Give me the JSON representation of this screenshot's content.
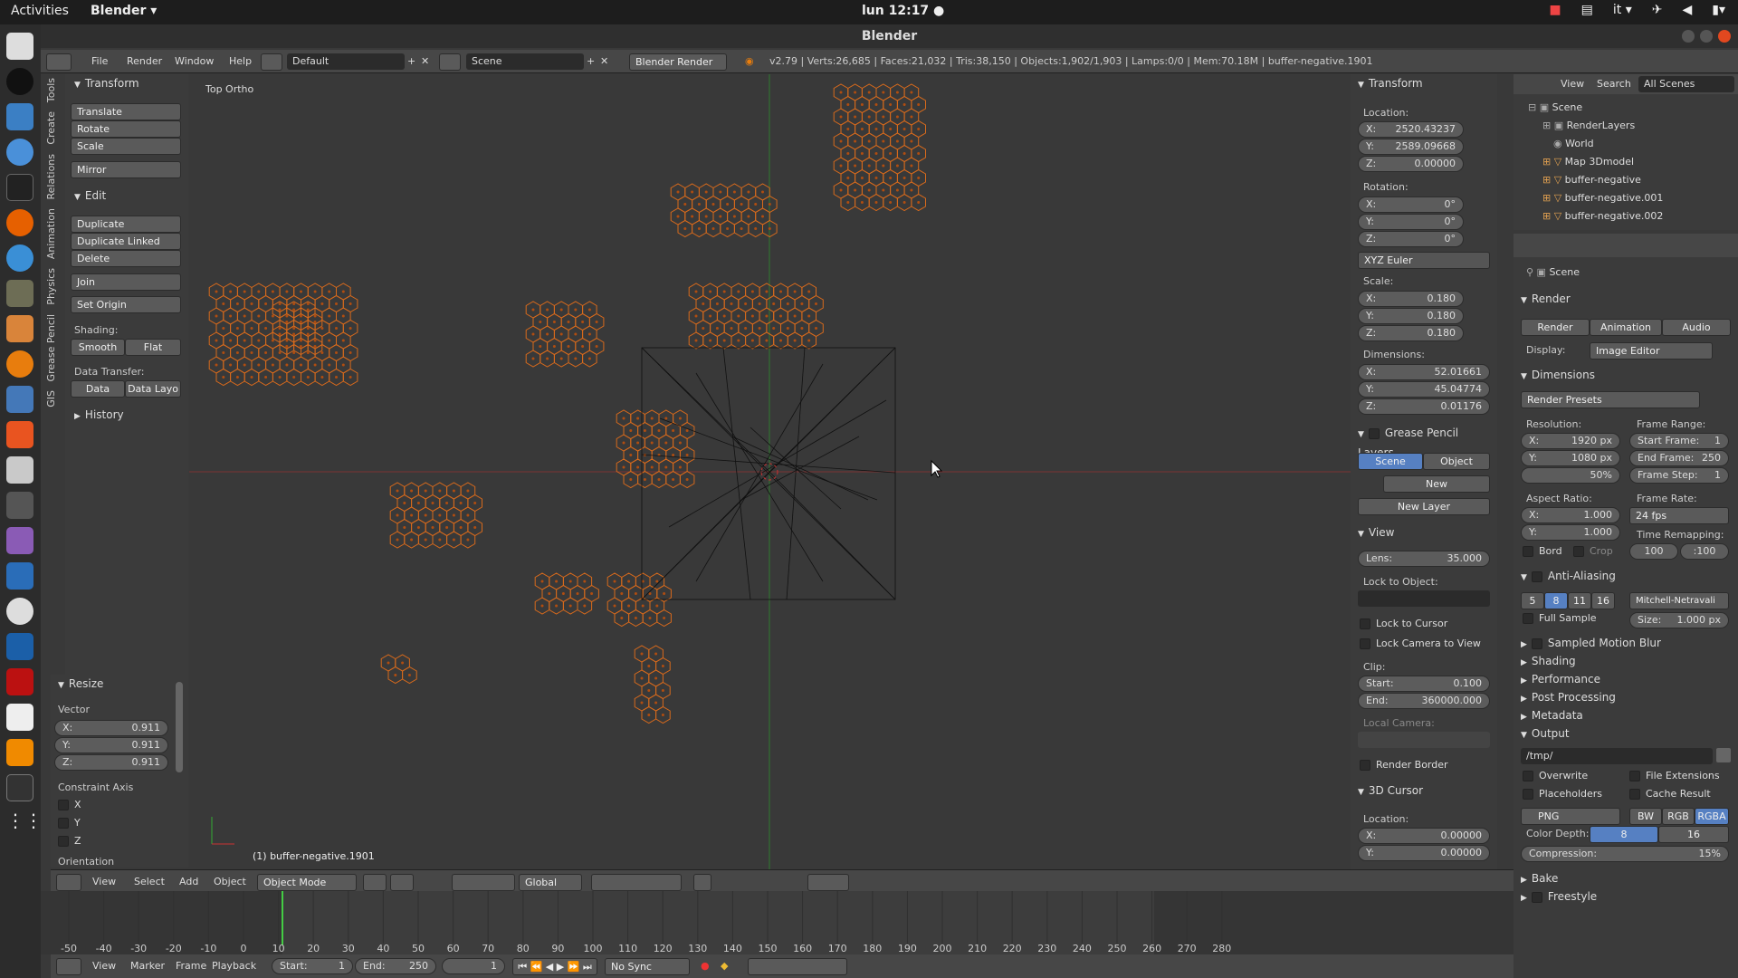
{
  "gnome": {
    "activities": "Activities",
    "app": "Blender ▾",
    "clock": "lun 12:17 ●",
    "lang": "it ▾"
  },
  "window": {
    "title": "Blender"
  },
  "info": {
    "menus": [
      "File",
      "Render",
      "Window",
      "Help"
    ],
    "layout": "Default",
    "scene": "Scene",
    "engine": "Blender Render",
    "stats": "v2.79 | Verts:26,685 | Faces:21,032 | Tris:38,150 | Objects:1,902/1,903 | Lamps:0/0 | Mem:70.18M | buffer-negative.1901"
  },
  "tool_tabs": [
    "Tools",
    "Create",
    "Relations",
    "Animation",
    "Physics",
    "Grease Pencil",
    "GIS"
  ],
  "tools": {
    "transform_hdr": "Transform",
    "translate": "Translate",
    "rotate": "Rotate",
    "scale": "Scale",
    "mirror": "Mirror",
    "edit_hdr": "Edit",
    "duplicate": "Duplicate",
    "duplicate_linked": "Duplicate Linked",
    "delete": "Delete",
    "join": "Join",
    "set_origin": "Set Origin",
    "shading": "Shading:",
    "smooth": "Smooth",
    "flat": "Flat",
    "data_transfer": "Data Transfer:",
    "data": "Data",
    "data_layo": "Data Layo",
    "history": "History"
  },
  "resize": {
    "title": "Resize",
    "vector": "Vector",
    "x": "X:",
    "xv": "0.911",
    "y": "Y:",
    "yv": "0.911",
    "z": "Z:",
    "zv": "0.911",
    "constraint": "Constraint Axis",
    "cx": "X",
    "cy": "Y",
    "cz": "Z",
    "orientation": "Orientation"
  },
  "viewport": {
    "view_name": "Top Ortho",
    "object_label": "(1) buffer-negative.1901"
  },
  "props": {
    "transform": "Transform",
    "location": "Location:",
    "lx": "X:",
    "lxv": "2520.43237",
    "ly": "Y:",
    "lyv": "2589.09668",
    "lz": "Z:",
    "lzv": "0.00000",
    "rotation": "Rotation:",
    "rx": "X:",
    "rxv": "0°",
    "ry": "Y:",
    "ryv": "0°",
    "rz": "Z:",
    "rzv": "0°",
    "euler": "XYZ Euler",
    "scale": "Scale:",
    "sx": "X:",
    "sxv": "0.180",
    "sy": "Y:",
    "syv": "0.180",
    "sz": "Z:",
    "szv": "0.180",
    "dimensions": "Dimensions:",
    "dx": "X:",
    "dxv": "52.01661",
    "dy": "Y:",
    "dyv": "45.04774",
    "dz": "Z:",
    "dzv": "0.01176",
    "gp_layers": "Grease Pencil Layers",
    "scene_btn": "Scene",
    "object_btn": "Object",
    "new": "New",
    "new_layer": "New Layer",
    "view": "View",
    "lens": "Lens:",
    "lensv": "35.000",
    "lock_obj": "Lock to Object:",
    "lock_cursor": "Lock to Cursor",
    "lock_camera": "Lock Camera to View",
    "clip": "Clip:",
    "start": "Start:",
    "startv": "0.100",
    "end": "End:",
    "endv": "360000.000",
    "local_camera": "Local Camera:",
    "render_border": "Render Border",
    "cursor3d": "3D Cursor",
    "c_location": "Location:",
    "cx": "X:",
    "cxv": "0.00000",
    "cy": "Y:",
    "cyv": "0.00000"
  },
  "outliner": {
    "view": "View",
    "search": "Search",
    "all_scenes": "All Scenes",
    "items": [
      "Scene",
      "RenderLayers",
      "World",
      "Map 3Dmodel",
      "buffer-negative",
      "buffer-negative.001",
      "buffer-negative.002"
    ]
  },
  "render": {
    "context": "Scene",
    "render_hdr": "Render",
    "render_btn": "Render",
    "animation_btn": "Animation",
    "audio_btn": "Audio",
    "display": "Display:",
    "display_val": "Image Editor",
    "dimensions": "Dimensions",
    "presets": "Render Presets",
    "resolution": "Resolution:",
    "resx": "X:",
    "resxv": "1920 px",
    "resy": "Y:",
    "resyv": "1080 px",
    "pct": "50%",
    "frame_range": "Frame Range:",
    "start_frame": "Start Frame:",
    "start_frame_v": "1",
    "end_frame": "End Frame:",
    "end_frame_v": "250",
    "frame_step": "Frame Step:",
    "frame_step_v": "1",
    "aspect": "Aspect Ratio:",
    "ax": "X:",
    "axv": "1.000",
    "ay": "Y:",
    "ayv": "1.000",
    "frame_rate": "Frame Rate:",
    "fps": "24 fps",
    "time_remap": "Time Remapping:",
    "remap_old": "100",
    "remap_new": ":100",
    "bord": "Bord",
    "crop": "Crop",
    "anti_aliasing": "Anti-Aliasing",
    "aa": [
      "5",
      "8",
      "11",
      "16"
    ],
    "filter": "Mitchell-Netravali",
    "full_sample": "Full Sample",
    "size": "Size:",
    "sizev": "1.000 px",
    "motion_blur": "Sampled Motion Blur",
    "shading": "Shading",
    "performance": "Performance",
    "post": "Post Processing",
    "metadata": "Metadata",
    "output": "Output",
    "path": "/tmp/",
    "overwrite": "Overwrite",
    "file_ext": "File Extensions",
    "placeholders": "Placeholders",
    "cache": "Cache Result",
    "format": "PNG",
    "bw": "BW",
    "rgb": "RGB",
    "rgba": "RGBA",
    "color_depth": "Color Depth:",
    "cd8": "8",
    "cd16": "16",
    "compression": "Compression:",
    "compv": "15%",
    "bake": "Bake",
    "freestyle": "Freestyle"
  },
  "v3d": {
    "view": "View",
    "select": "Select",
    "add": "Add",
    "object": "Object",
    "mode": "Object Mode",
    "orientation": "Global"
  },
  "timeline": {
    "ticks": [
      "-50",
      "-40",
      "-30",
      "-20",
      "-10",
      "0",
      "10",
      "20",
      "30",
      "40",
      "50",
      "60",
      "70",
      "80",
      "90",
      "100",
      "110",
      "120",
      "130",
      "140",
      "150",
      "160",
      "170",
      "180",
      "190",
      "200",
      "210",
      "220",
      "230",
      "240",
      "250",
      "260",
      "270",
      "280"
    ]
  },
  "tlh": {
    "view": "View",
    "marker": "Marker",
    "frame": "Frame",
    "playback": "Playback",
    "start": "Start:",
    "startv": "1",
    "end": "End:",
    "endv": "250",
    "current": "1",
    "sync": "No Sync"
  }
}
